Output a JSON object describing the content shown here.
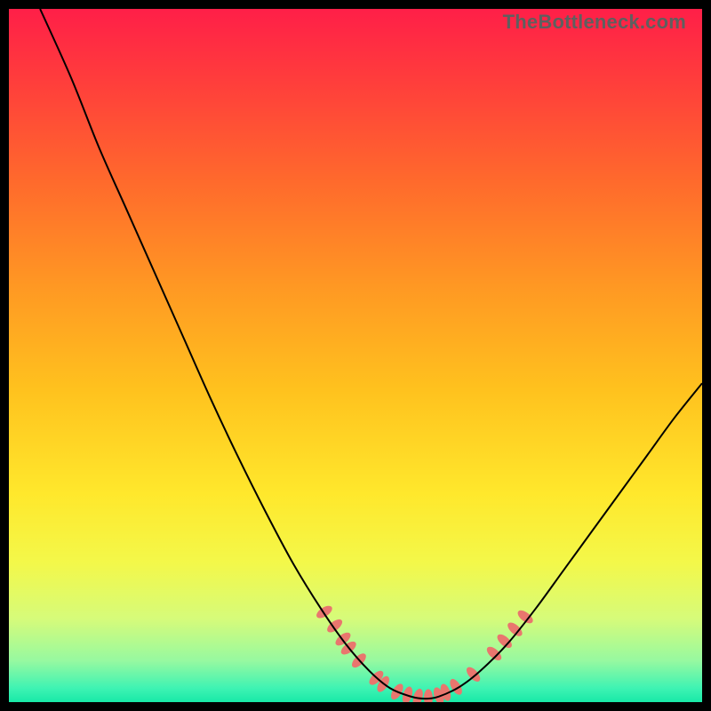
{
  "watermark": "TheBottleneck.com",
  "chart_data": {
    "type": "line",
    "title": "",
    "xlabel": "",
    "ylabel": "",
    "xlim": [
      0,
      100
    ],
    "ylim": [
      0,
      100
    ],
    "grid": false,
    "legend": false,
    "gradient_stops": [
      {
        "offset": 0.0,
        "color": "#ff1f48"
      },
      {
        "offset": 0.1,
        "color": "#ff3c3c"
      },
      {
        "offset": 0.25,
        "color": "#ff6a2c"
      },
      {
        "offset": 0.4,
        "color": "#ff9823"
      },
      {
        "offset": 0.55,
        "color": "#ffc21e"
      },
      {
        "offset": 0.7,
        "color": "#ffe82c"
      },
      {
        "offset": 0.8,
        "color": "#f3f84a"
      },
      {
        "offset": 0.88,
        "color": "#d6fb7a"
      },
      {
        "offset": 0.94,
        "color": "#97f9a0"
      },
      {
        "offset": 0.98,
        "color": "#3ef3b3"
      },
      {
        "offset": 1.0,
        "color": "#18e9a7"
      }
    ],
    "series": [
      {
        "name": "bottleneck-curve",
        "color": "#000000",
        "width": 2,
        "points": [
          {
            "x": 4.5,
            "y": 100.0
          },
          {
            "x": 9.0,
            "y": 90.0
          },
          {
            "x": 13.0,
            "y": 80.0
          },
          {
            "x": 17.0,
            "y": 71.0
          },
          {
            "x": 21.0,
            "y": 62.0
          },
          {
            "x": 25.0,
            "y": 53.0
          },
          {
            "x": 29.0,
            "y": 44.0
          },
          {
            "x": 33.0,
            "y": 35.5
          },
          {
            "x": 37.0,
            "y": 27.5
          },
          {
            "x": 41.0,
            "y": 20.0
          },
          {
            "x": 45.0,
            "y": 13.5
          },
          {
            "x": 48.5,
            "y": 8.5
          },
          {
            "x": 52.0,
            "y": 4.5
          },
          {
            "x": 55.0,
            "y": 2.0
          },
          {
            "x": 58.0,
            "y": 0.8
          },
          {
            "x": 60.0,
            "y": 0.5
          },
          {
            "x": 62.0,
            "y": 0.8
          },
          {
            "x": 65.0,
            "y": 2.2
          },
          {
            "x": 68.0,
            "y": 4.5
          },
          {
            "x": 72.0,
            "y": 8.5
          },
          {
            "x": 76.0,
            "y": 13.5
          },
          {
            "x": 80.0,
            "y": 19.0
          },
          {
            "x": 84.0,
            "y": 24.5
          },
          {
            "x": 88.0,
            "y": 30.0
          },
          {
            "x": 92.0,
            "y": 35.5
          },
          {
            "x": 96.0,
            "y": 41.0
          },
          {
            "x": 100.0,
            "y": 46.0
          }
        ]
      }
    ],
    "markers": {
      "name": "highlighted-samples",
      "color": "#e9766e",
      "radius_x": 5,
      "radius_y": 10,
      "points": [
        {
          "x": 45.5,
          "y": 13.0
        },
        {
          "x": 47.0,
          "y": 11.0
        },
        {
          "x": 48.2,
          "y": 9.1
        },
        {
          "x": 49.0,
          "y": 7.8
        },
        {
          "x": 50.5,
          "y": 6.0
        },
        {
          "x": 53.0,
          "y": 3.5
        },
        {
          "x": 54.0,
          "y": 2.6
        },
        {
          "x": 56.0,
          "y": 1.5
        },
        {
          "x": 57.5,
          "y": 1.0
        },
        {
          "x": 59.0,
          "y": 0.7
        },
        {
          "x": 60.5,
          "y": 0.6
        },
        {
          "x": 62.0,
          "y": 0.9
        },
        {
          "x": 63.0,
          "y": 1.4
        },
        {
          "x": 64.5,
          "y": 2.2
        },
        {
          "x": 67.0,
          "y": 4.0
        },
        {
          "x": 70.0,
          "y": 7.0
        },
        {
          "x": 71.5,
          "y": 8.8
        },
        {
          "x": 73.0,
          "y": 10.5
        },
        {
          "x": 74.5,
          "y": 12.3
        }
      ]
    }
  }
}
